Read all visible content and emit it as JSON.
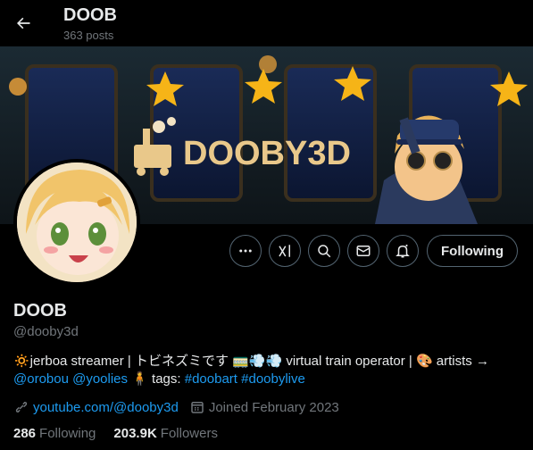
{
  "header": {
    "title": "DOOB",
    "posts": "363 posts"
  },
  "banner": {
    "logo_text": "DOOBY3D"
  },
  "profile": {
    "display_name": "DOOB",
    "handle": "@dooby3d",
    "follow_button": "Following",
    "bio": {
      "line1_a": "🔅jerboa streamer | トビネズミです 🚃💨💨 virtual train operator | 🎨 artists →",
      "mention1": "@orobou",
      "mention2": "@yoolies",
      "tags_label": "🧍 tags:",
      "tag1": "#doobart",
      "tag2": "#doobylive"
    },
    "website": "youtube.com/@dooby3d",
    "joined": "Joined February 2023",
    "following_count": "286",
    "following_label": "Following",
    "followers_count": "203.9K",
    "followers_label": "Followers"
  },
  "colors": {
    "accent": "#1d9bf0",
    "muted": "#71767b",
    "text": "#e7e9ea",
    "border": "#536471"
  },
  "icons": [
    "back-arrow-icon",
    "more-icon",
    "grok-icon",
    "search-icon",
    "message-icon",
    "notification-bell-icon",
    "link-icon",
    "calendar-icon"
  ]
}
